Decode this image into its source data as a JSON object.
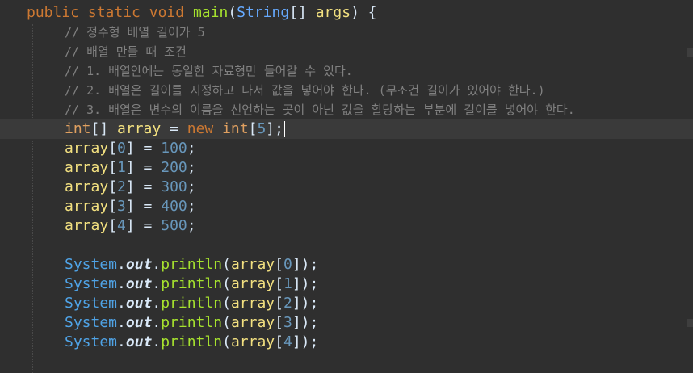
{
  "editor": {
    "lines": [
      {
        "type": "code",
        "tokens": [
          {
            "t": "public",
            "c": "kw"
          },
          {
            "t": " ",
            "c": "punc"
          },
          {
            "t": "static",
            "c": "kw"
          },
          {
            "t": " ",
            "c": "punc"
          },
          {
            "t": "void",
            "c": "kw"
          },
          {
            "t": " ",
            "c": "punc"
          },
          {
            "t": "main",
            "c": "method"
          },
          {
            "t": "(",
            "c": "punc"
          },
          {
            "t": "String",
            "c": "type"
          },
          {
            "t": "[] ",
            "c": "punc"
          },
          {
            "t": "args",
            "c": "var"
          },
          {
            "t": ") {",
            "c": "punc"
          }
        ]
      },
      {
        "type": "comment",
        "text": "// 정수형 배열 길이가 5"
      },
      {
        "type": "comment",
        "text": "// 배열 만들 때 조건"
      },
      {
        "type": "comment",
        "text": "// 1. 배열안에는 동일한 자료형만 들어갈 수 있다."
      },
      {
        "type": "comment",
        "text": "// 2. 배열은 길이를 지정하고 나서 값을 넣어야 한다. (무조건 길이가 있어야 한다.)"
      },
      {
        "type": "comment",
        "text": "// 3. 배열은 변수의 이름을 선언하는 곳이 아닌 값을 할당하는 부분에 길이를 넣어야 한다."
      },
      {
        "type": "code",
        "current": true,
        "tokens": [
          {
            "t": "int",
            "c": "kw-lt"
          },
          {
            "t": "[] ",
            "c": "punc"
          },
          {
            "t": "array",
            "c": "var"
          },
          {
            "t": " = ",
            "c": "punc"
          },
          {
            "t": "new",
            "c": "kw"
          },
          {
            "t": " ",
            "c": "punc"
          },
          {
            "t": "int",
            "c": "kw-lt"
          },
          {
            "t": "[",
            "c": "punc"
          },
          {
            "t": "5",
            "c": "num"
          },
          {
            "t": "];",
            "c": "punc"
          }
        ]
      },
      {
        "type": "code",
        "tokens": [
          {
            "t": "array",
            "c": "var"
          },
          {
            "t": "[",
            "c": "punc"
          },
          {
            "t": "0",
            "c": "num"
          },
          {
            "t": "] = ",
            "c": "punc"
          },
          {
            "t": "100",
            "c": "num"
          },
          {
            "t": ";",
            "c": "punc"
          }
        ]
      },
      {
        "type": "code",
        "tokens": [
          {
            "t": "array",
            "c": "var"
          },
          {
            "t": "[",
            "c": "punc"
          },
          {
            "t": "1",
            "c": "num"
          },
          {
            "t": "] = ",
            "c": "punc"
          },
          {
            "t": "200",
            "c": "num"
          },
          {
            "t": ";",
            "c": "punc"
          }
        ]
      },
      {
        "type": "code",
        "tokens": [
          {
            "t": "array",
            "c": "var"
          },
          {
            "t": "[",
            "c": "punc"
          },
          {
            "t": "2",
            "c": "num"
          },
          {
            "t": "] = ",
            "c": "punc"
          },
          {
            "t": "300",
            "c": "num"
          },
          {
            "t": ";",
            "c": "punc"
          }
        ]
      },
      {
        "type": "code",
        "tokens": [
          {
            "t": "array",
            "c": "var"
          },
          {
            "t": "[",
            "c": "punc"
          },
          {
            "t": "3",
            "c": "num"
          },
          {
            "t": "] = ",
            "c": "punc"
          },
          {
            "t": "400",
            "c": "num"
          },
          {
            "t": ";",
            "c": "punc"
          }
        ]
      },
      {
        "type": "code",
        "tokens": [
          {
            "t": "array",
            "c": "var"
          },
          {
            "t": "[",
            "c": "punc"
          },
          {
            "t": "4",
            "c": "num"
          },
          {
            "t": "] = ",
            "c": "punc"
          },
          {
            "t": "500",
            "c": "num"
          },
          {
            "t": ";",
            "c": "punc"
          }
        ]
      },
      {
        "type": "blank"
      },
      {
        "type": "code",
        "tokens": [
          {
            "t": "System",
            "c": "sys"
          },
          {
            "t": ".",
            "c": "punc"
          },
          {
            "t": "out",
            "c": "field"
          },
          {
            "t": ".",
            "c": "punc"
          },
          {
            "t": "println",
            "c": "method"
          },
          {
            "t": "(",
            "c": "punc"
          },
          {
            "t": "array",
            "c": "var"
          },
          {
            "t": "[",
            "c": "punc"
          },
          {
            "t": "0",
            "c": "num"
          },
          {
            "t": "]);",
            "c": "punc"
          }
        ]
      },
      {
        "type": "code",
        "tokens": [
          {
            "t": "System",
            "c": "sys"
          },
          {
            "t": ".",
            "c": "punc"
          },
          {
            "t": "out",
            "c": "field"
          },
          {
            "t": ".",
            "c": "punc"
          },
          {
            "t": "println",
            "c": "method"
          },
          {
            "t": "(",
            "c": "punc"
          },
          {
            "t": "array",
            "c": "var"
          },
          {
            "t": "[",
            "c": "punc"
          },
          {
            "t": "1",
            "c": "num"
          },
          {
            "t": "]);",
            "c": "punc"
          }
        ]
      },
      {
        "type": "code",
        "tokens": [
          {
            "t": "System",
            "c": "sys"
          },
          {
            "t": ".",
            "c": "punc"
          },
          {
            "t": "out",
            "c": "field"
          },
          {
            "t": ".",
            "c": "punc"
          },
          {
            "t": "println",
            "c": "method"
          },
          {
            "t": "(",
            "c": "punc"
          },
          {
            "t": "array",
            "c": "var"
          },
          {
            "t": "[",
            "c": "punc"
          },
          {
            "t": "2",
            "c": "num"
          },
          {
            "t": "]);",
            "c": "punc"
          }
        ]
      },
      {
        "type": "code",
        "tokens": [
          {
            "t": "System",
            "c": "sys"
          },
          {
            "t": ".",
            "c": "punc"
          },
          {
            "t": "out",
            "c": "field"
          },
          {
            "t": ".",
            "c": "punc"
          },
          {
            "t": "println",
            "c": "method"
          },
          {
            "t": "(",
            "c": "punc"
          },
          {
            "t": "array",
            "c": "var"
          },
          {
            "t": "[",
            "c": "punc"
          },
          {
            "t": "3",
            "c": "num"
          },
          {
            "t": "]);",
            "c": "punc"
          }
        ]
      },
      {
        "type": "code",
        "tokens": [
          {
            "t": "System",
            "c": "sys"
          },
          {
            "t": ".",
            "c": "punc"
          },
          {
            "t": "out",
            "c": "field"
          },
          {
            "t": ".",
            "c": "punc"
          },
          {
            "t": "println",
            "c": "method"
          },
          {
            "t": "(",
            "c": "punc"
          },
          {
            "t": "array",
            "c": "var"
          },
          {
            "t": "[",
            "c": "punc"
          },
          {
            "t": "4",
            "c": "num"
          },
          {
            "t": "]);",
            "c": "punc"
          }
        ]
      }
    ]
  }
}
